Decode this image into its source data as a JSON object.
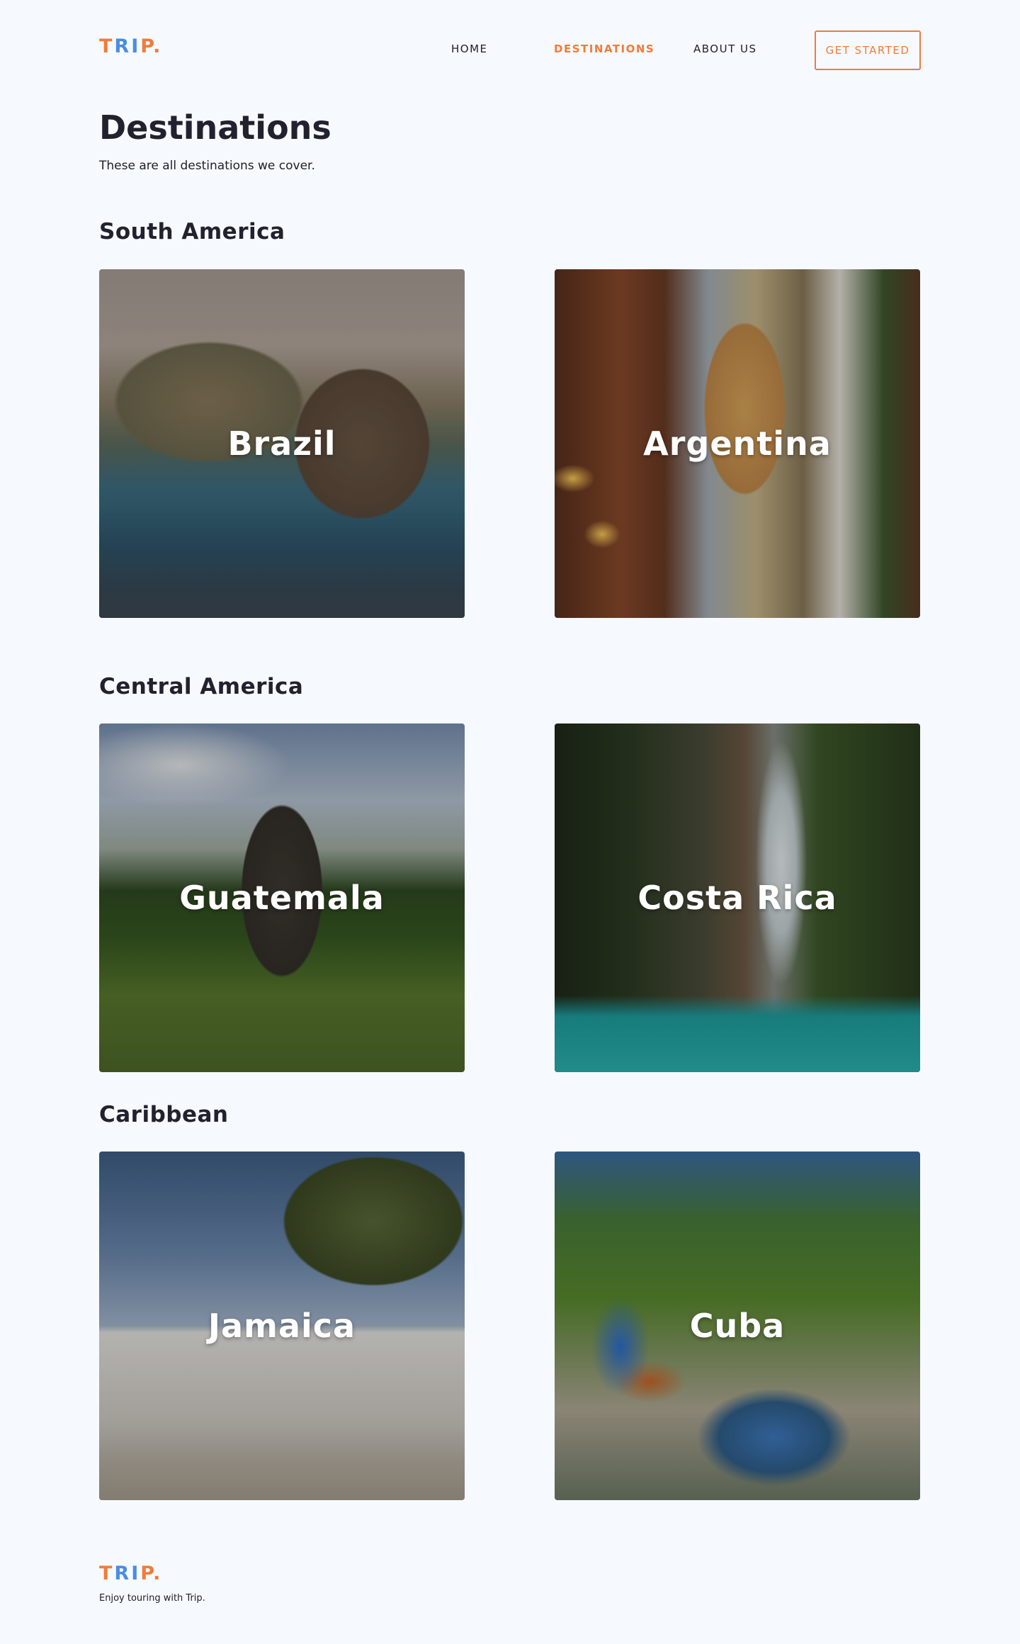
{
  "header": {
    "logo_letters": [
      "T",
      "R",
      "I",
      "P",
      "."
    ],
    "nav": [
      {
        "label": "HOME"
      },
      {
        "label": "DESTINATIONS"
      },
      {
        "label": "ABOUT US"
      }
    ],
    "cta_label": "GET STARTED"
  },
  "main": {
    "title": "Destinations",
    "subtitle": "These are all destinations we cover.",
    "regions": [
      {
        "title": "South America",
        "destinations": [
          {
            "name": "Brazil"
          },
          {
            "name": "Argentina"
          }
        ]
      },
      {
        "title": "Central America",
        "destinations": [
          {
            "name": "Guatemala"
          },
          {
            "name": "Costa Rica"
          }
        ]
      },
      {
        "title": "Caribbean",
        "destinations": [
          {
            "name": "Jamaica"
          },
          {
            "name": "Cuba"
          }
        ]
      }
    ]
  },
  "footer": {
    "logo_letters": [
      "T",
      "R",
      "I",
      "P",
      "."
    ],
    "tagline": "Enjoy touring with Trip."
  },
  "colors": {
    "accent": "#f07c3a",
    "logo_blue": "#4a8de0",
    "text": "#22212e",
    "background": "#f6f9fd"
  }
}
